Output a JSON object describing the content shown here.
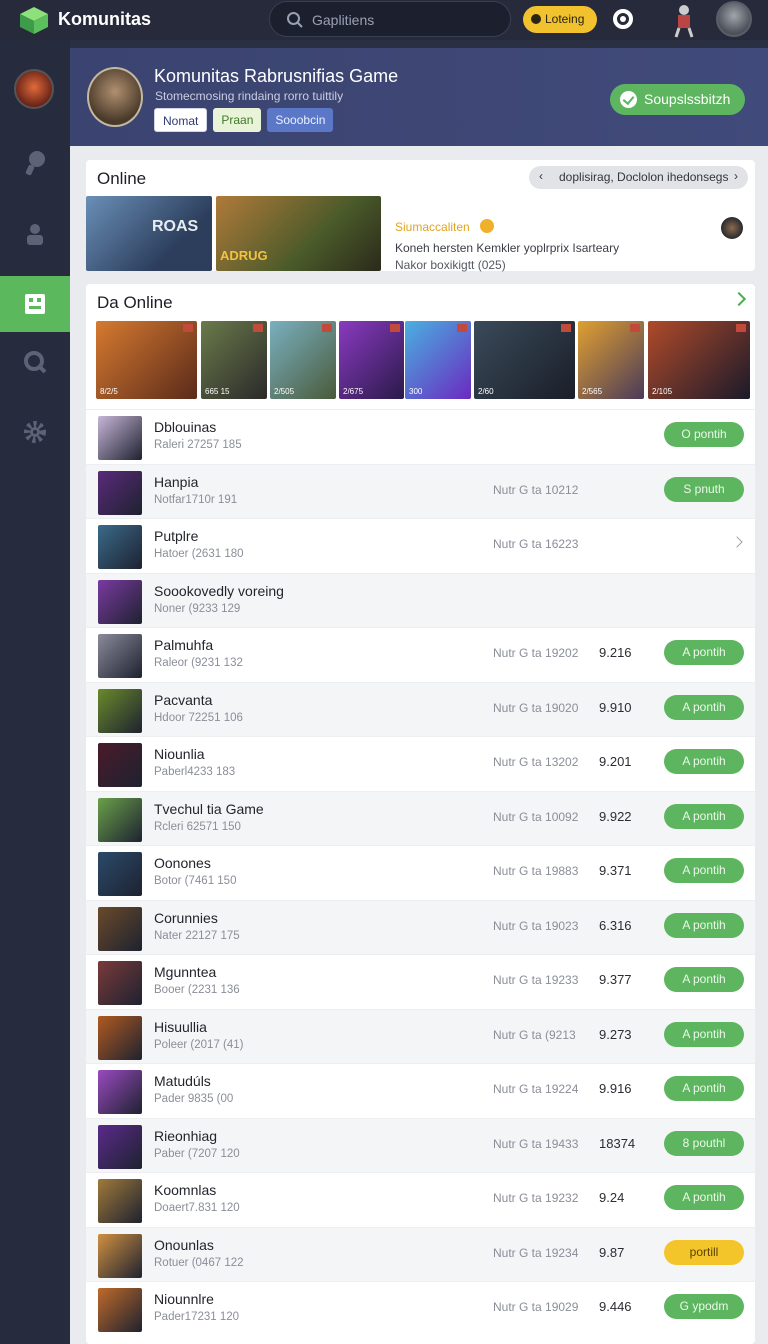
{
  "topbar": {
    "brand": "Komunitas",
    "search_placeholder": "Gaplitiens",
    "load_label": "Loteing"
  },
  "header": {
    "title": "Komunitas Rabrusnifias Game",
    "subtitle": "Stomecmosing rindaing rorro tuittily",
    "tags": [
      "Nomat",
      "Praan",
      "Sooobcin"
    ],
    "action_label": "Soupslssbitzh"
  },
  "online": {
    "title": "Online",
    "pager_label": "doplisirag, Doclolon ihedonsegs",
    "thumbs": [
      "ROAS",
      "ADRUG"
    ],
    "feature": {
      "title": "Siumaccaliten",
      "line1": "Koneh hersten Kemkler yoplrprix Isarteary",
      "line2": "Nakor boxikigtt (025)"
    }
  },
  "da_online": {
    "title": "Da Online",
    "gallery": [
      "8/2/5",
      "665 15",
      "2/505",
      "2/675",
      "300",
      "2/60",
      "2/565",
      "2/105"
    ],
    "rows": [
      {
        "name": "Dblouinas",
        "sub": "Raleri 27257 185",
        "meta": "",
        "score": "",
        "action": "O pontih",
        "style": "green"
      },
      {
        "name": "Hanpia",
        "sub": "Notfar1710r 191",
        "meta": "Nutr G ta 10212",
        "score": "",
        "action": "S pnuth",
        "style": "green"
      },
      {
        "name": "Putplre",
        "sub": "Hatoer (2631 180",
        "meta": "Nutr G ta 16223",
        "score": "",
        "action": "",
        "style": "arrow"
      },
      {
        "name": "Soookovedly voreing",
        "sub": "Noner (9233 129",
        "meta": "",
        "score": "",
        "action": "",
        "style": "none"
      },
      {
        "name": "Palmuhfa",
        "sub": "Raleor (9231 132",
        "meta": "Nutr G ta 19202",
        "score": "9.216",
        "action": "A pontih",
        "style": "green"
      },
      {
        "name": "Pacvanta",
        "sub": "Hdoor 72251 106",
        "meta": "Nutr G ta 19020",
        "score": "9.910",
        "action": "A pontih",
        "style": "green"
      },
      {
        "name": "Niounlia",
        "sub": "Paberl4233 183",
        "meta": "Nutr G ta 13202",
        "score": "9.201",
        "action": "A pontih",
        "style": "green"
      },
      {
        "name": "Tvechul tia Game",
        "sub": "Rcleri 62571 150",
        "meta": "Nutr G ta 10092",
        "score": "9.922",
        "action": "A pontih",
        "style": "green"
      },
      {
        "name": "Oonones",
        "sub": "Botor (7461 150",
        "meta": "Nutr G ta 19883",
        "score": "9.371",
        "action": "A pontih",
        "style": "green"
      },
      {
        "name": "Corunnies",
        "sub": "Nater 22127 175",
        "meta": "Nutr G ta 19023",
        "score": "6.316",
        "action": "A pontih",
        "style": "green"
      },
      {
        "name": "Mgunntea",
        "sub": "Booer (2231 136",
        "meta": "Nutr G ta 19233",
        "score": "9.377",
        "action": "A pontih",
        "style": "green"
      },
      {
        "name": "Hisuullia",
        "sub": "Poleer (2017 (41)",
        "meta": "Nutr G ta (9213",
        "score": "9.273",
        "action": "A pontih",
        "style": "green"
      },
      {
        "name": "Matudúls",
        "sub": "Pader 9835 (00",
        "meta": "Nutr G ta 19224",
        "score": "9.916",
        "action": "A pontih",
        "style": "green"
      },
      {
        "name": "Rieonhiag",
        "sub": "Paber (7207 120",
        "meta": "Nutr G ta 19433",
        "score": "18374",
        "action": "8 pouthl",
        "style": "green"
      },
      {
        "name": "Koomnlas",
        "sub": "Doaert7.831 120",
        "meta": "Nutr G ta 19232",
        "score": "9.24",
        "action": "A pontih",
        "style": "green"
      },
      {
        "name": "Onounlas",
        "sub": "Rotuer (0467 122",
        "meta": "Nutr G ta 19234",
        "score": "9.87",
        "action": "portill",
        "style": "yellow"
      },
      {
        "name": "Niounnlre",
        "sub": "Pader17231 120",
        "meta": "Nutr G ta 19029",
        "score": "9.446",
        "action": "G ypodm",
        "style": "green"
      }
    ]
  }
}
